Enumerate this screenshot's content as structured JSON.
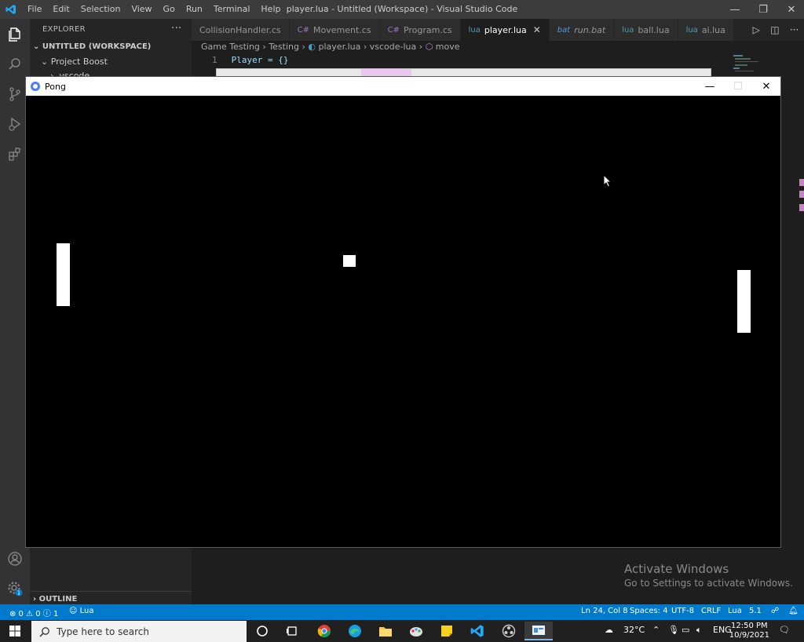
{
  "titlebar": {
    "menu": [
      "File",
      "Edit",
      "Selection",
      "View",
      "Go",
      "Run",
      "Terminal",
      "Help"
    ],
    "window_title": "player.lua - Untitled (Workspace) - Visual Studio Code",
    "minimize": "—",
    "maximize": "❐",
    "close": "✕"
  },
  "sidebar": {
    "header": "EXPLORER",
    "more": "···",
    "workspace": "UNTITLED (WORKSPACE)",
    "project": "Project Boost",
    "folder": ".vscode",
    "outline": "OUTLINE"
  },
  "tabs": [
    {
      "label": "CollisionHandler.cs",
      "icon": "",
      "active": false
    },
    {
      "label": "Movement.cs",
      "icon": "C#",
      "active": false
    },
    {
      "label": "Program.cs",
      "icon": "C#",
      "active": false
    },
    {
      "label": "player.lua",
      "icon": "lua",
      "active": true
    },
    {
      "label": "run.bat",
      "icon": "bat",
      "active": false
    },
    {
      "label": "ball.lua",
      "icon": "lua",
      "active": false
    },
    {
      "label": "ai.lua",
      "icon": "lua",
      "active": false
    }
  ],
  "breadcrumb": [
    "Game Testing",
    "Testing",
    "player.lua",
    "vscode-lua",
    "move"
  ],
  "editor": {
    "line_number": "1",
    "code": "Player = {}"
  },
  "pong": {
    "title": "Pong",
    "minimize": "—",
    "maximize": "☐",
    "close": "✕"
  },
  "watermark": {
    "line1": "Activate Windows",
    "line2": "Go to Settings to activate Windows."
  },
  "statusbar": {
    "problems": "⊗ 0 ⚠ 0 ⓘ 1",
    "lua": "Lua",
    "position": "Ln 24, Col 8",
    "spaces": "Spaces: 4",
    "encoding": "UTF-8",
    "eol": "CRLF",
    "language": "Lua",
    "version": "5.1"
  },
  "taskbar": {
    "search_placeholder": "Type here to search",
    "weather": "32°C",
    "lang": "ENG",
    "time": "12:50 PM",
    "date": "10/9/2021"
  },
  "colors": {
    "accent": "#007acc",
    "activitybar": "#333333",
    "sidebar": "#252526",
    "editor": "#1e1e1e",
    "pong_bg": "#000000",
    "pong_fg": "#ffffff"
  }
}
